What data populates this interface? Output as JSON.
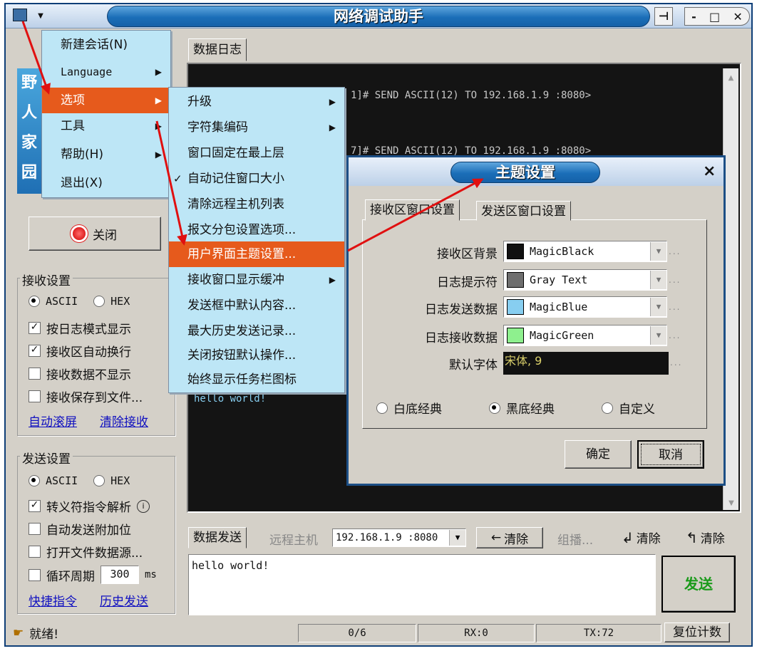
{
  "window": {
    "title": "网络调试助手",
    "pin_icon": "pin-icon",
    "min_label": "-",
    "max_label": "□",
    "close_label": "✕"
  },
  "sidebar": {
    "logo_text": [
      "野",
      "人",
      "家",
      "园"
    ],
    "close_button_label": "关闭",
    "receive_group": {
      "title": "接收设置",
      "radio_ascii": "ASCII",
      "radio_hex": "HEX",
      "checkboxes": [
        {
          "label": "按日志模式显示",
          "checked": true
        },
        {
          "label": "接收区自动换行",
          "checked": true
        },
        {
          "label": "接收数据不显示",
          "checked": false
        },
        {
          "label": "接收保存到文件...",
          "checked": false
        }
      ],
      "link_autoscroll": "自动滚屏",
      "link_clear": "清除接收"
    },
    "send_group": {
      "title": "发送设置",
      "radio_ascii": "ASCII",
      "radio_hex": "HEX",
      "checkboxes": [
        {
          "label": "转义符指令解析",
          "checked": true
        },
        {
          "label": "自动发送附加位",
          "checked": false
        },
        {
          "label": "打开文件数据源...",
          "checked": false
        }
      ],
      "loop_label": "循环周期",
      "loop_value": "300",
      "loop_unit": "ms",
      "link_shortcut": "快捷指令",
      "link_history": "历史发送"
    }
  },
  "log": {
    "tab": "数据日志",
    "lines": [
      "1]# SEND ASCII(12) TO 192.168.1.9 :8080>",
      "7]# SEND ASCII(12) TO 192.168.1.9 :8080>"
    ],
    "hello": "hello world!"
  },
  "send_bar": {
    "tab": "数据发送",
    "remote_label": "远程主机",
    "remote_value": "192.168.1.9 :8080",
    "clear_button": "清除",
    "multicast": "组播...",
    "clear2": "清除",
    "clear3": "清除",
    "input_text": "hello world!",
    "send_button": "发送"
  },
  "status": {
    "ready": "就绪!",
    "count": "0/6",
    "rx": "RX:0",
    "tx": "TX:72",
    "reset": "复位计数"
  },
  "main_menu": {
    "items": [
      {
        "label": "新建会话(N)",
        "submenu": false
      },
      {
        "label": "Language",
        "submenu": true
      },
      {
        "label": "选项",
        "submenu": true
      },
      {
        "label": "工具",
        "submenu": true
      },
      {
        "label": "帮助(H)",
        "submenu": true
      },
      {
        "label": "退出(X)",
        "submenu": false
      }
    ]
  },
  "options_menu": {
    "items": [
      {
        "label": "升级",
        "submenu": true
      },
      {
        "label": "字符集编码",
        "submenu": true
      },
      {
        "label": "窗口固定在最上层"
      },
      {
        "label": "自动记住窗口大小",
        "checked": true
      },
      {
        "label": "清除远程主机列表"
      },
      {
        "label": "报文分包设置选项..."
      },
      {
        "label": "用户界面主题设置..."
      },
      {
        "label": "接收窗口显示缓冲",
        "submenu": true
      },
      {
        "label": "发送框中默认内容..."
      },
      {
        "label": "最大历史发送记录..."
      },
      {
        "label": "关闭按钮默认操作..."
      },
      {
        "label": "始终显示任务栏图标"
      }
    ]
  },
  "theme_dialog": {
    "title": "主题设置",
    "close": "×",
    "tab_receive": "接收区窗口设置",
    "tab_send": "发送区窗口设置",
    "rows": [
      {
        "label": "接收区背景",
        "value": "MagicBlack",
        "color": "#111111"
      },
      {
        "label": "日志提示符",
        "value": "Gray Text",
        "color": "#6e6e6e"
      },
      {
        "label": "日志发送数据",
        "value": "MagicBlue",
        "color": "#87cef0"
      },
      {
        "label": "日志接收数据",
        "value": "MagicGreen",
        "color": "#8ef08e"
      }
    ],
    "font_label": "默认字体",
    "font_value": "宋体, 9",
    "preset_white": "白底经典",
    "preset_black": "黑底经典",
    "preset_custom": "自定义",
    "ok": "确定",
    "cancel": "取消"
  },
  "colors": {
    "highlight": "#e65a1c",
    "menu_bg": "#bde6f6",
    "arrow": "#e01010",
    "send_text": "#1a9a1a"
  }
}
